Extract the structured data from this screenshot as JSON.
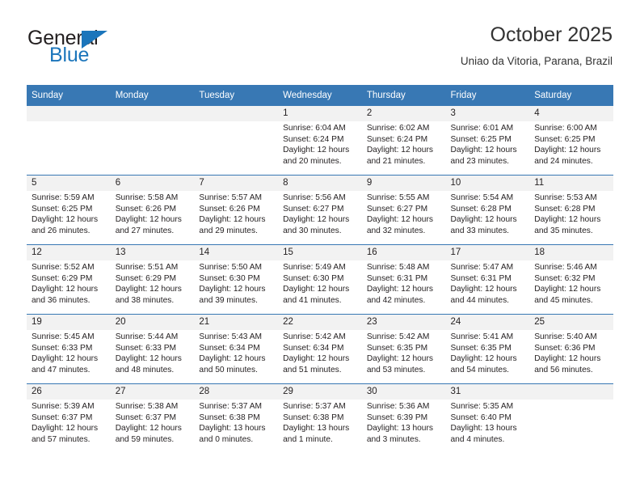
{
  "brand": {
    "name_part1": "General",
    "name_part2": "Blue",
    "accent_color": "#1b75bb"
  },
  "header": {
    "title": "October 2025",
    "subtitle": "Uniao da Vitoria, Parana, Brazil"
  },
  "theme": {
    "header_blue": "#3878b4",
    "row_band_gray": "#f2f2f2"
  },
  "weekdays": [
    "Sunday",
    "Monday",
    "Tuesday",
    "Wednesday",
    "Thursday",
    "Friday",
    "Saturday"
  ],
  "weeks": [
    [
      {
        "day": "",
        "lines": []
      },
      {
        "day": "",
        "lines": []
      },
      {
        "day": "",
        "lines": []
      },
      {
        "day": "1",
        "lines": [
          "Sunrise: 6:04 AM",
          "Sunset: 6:24 PM",
          "Daylight: 12 hours",
          "and 20 minutes."
        ]
      },
      {
        "day": "2",
        "lines": [
          "Sunrise: 6:02 AM",
          "Sunset: 6:24 PM",
          "Daylight: 12 hours",
          "and 21 minutes."
        ]
      },
      {
        "day": "3",
        "lines": [
          "Sunrise: 6:01 AM",
          "Sunset: 6:25 PM",
          "Daylight: 12 hours",
          "and 23 minutes."
        ]
      },
      {
        "day": "4",
        "lines": [
          "Sunrise: 6:00 AM",
          "Sunset: 6:25 PM",
          "Daylight: 12 hours",
          "and 24 minutes."
        ]
      }
    ],
    [
      {
        "day": "5",
        "lines": [
          "Sunrise: 5:59 AM",
          "Sunset: 6:25 PM",
          "Daylight: 12 hours",
          "and 26 minutes."
        ]
      },
      {
        "day": "6",
        "lines": [
          "Sunrise: 5:58 AM",
          "Sunset: 6:26 PM",
          "Daylight: 12 hours",
          "and 27 minutes."
        ]
      },
      {
        "day": "7",
        "lines": [
          "Sunrise: 5:57 AM",
          "Sunset: 6:26 PM",
          "Daylight: 12 hours",
          "and 29 minutes."
        ]
      },
      {
        "day": "8",
        "lines": [
          "Sunrise: 5:56 AM",
          "Sunset: 6:27 PM",
          "Daylight: 12 hours",
          "and 30 minutes."
        ]
      },
      {
        "day": "9",
        "lines": [
          "Sunrise: 5:55 AM",
          "Sunset: 6:27 PM",
          "Daylight: 12 hours",
          "and 32 minutes."
        ]
      },
      {
        "day": "10",
        "lines": [
          "Sunrise: 5:54 AM",
          "Sunset: 6:28 PM",
          "Daylight: 12 hours",
          "and 33 minutes."
        ]
      },
      {
        "day": "11",
        "lines": [
          "Sunrise: 5:53 AM",
          "Sunset: 6:28 PM",
          "Daylight: 12 hours",
          "and 35 minutes."
        ]
      }
    ],
    [
      {
        "day": "12",
        "lines": [
          "Sunrise: 5:52 AM",
          "Sunset: 6:29 PM",
          "Daylight: 12 hours",
          "and 36 minutes."
        ]
      },
      {
        "day": "13",
        "lines": [
          "Sunrise: 5:51 AM",
          "Sunset: 6:29 PM",
          "Daylight: 12 hours",
          "and 38 minutes."
        ]
      },
      {
        "day": "14",
        "lines": [
          "Sunrise: 5:50 AM",
          "Sunset: 6:30 PM",
          "Daylight: 12 hours",
          "and 39 minutes."
        ]
      },
      {
        "day": "15",
        "lines": [
          "Sunrise: 5:49 AM",
          "Sunset: 6:30 PM",
          "Daylight: 12 hours",
          "and 41 minutes."
        ]
      },
      {
        "day": "16",
        "lines": [
          "Sunrise: 5:48 AM",
          "Sunset: 6:31 PM",
          "Daylight: 12 hours",
          "and 42 minutes."
        ]
      },
      {
        "day": "17",
        "lines": [
          "Sunrise: 5:47 AM",
          "Sunset: 6:31 PM",
          "Daylight: 12 hours",
          "and 44 minutes."
        ]
      },
      {
        "day": "18",
        "lines": [
          "Sunrise: 5:46 AM",
          "Sunset: 6:32 PM",
          "Daylight: 12 hours",
          "and 45 minutes."
        ]
      }
    ],
    [
      {
        "day": "19",
        "lines": [
          "Sunrise: 5:45 AM",
          "Sunset: 6:33 PM",
          "Daylight: 12 hours",
          "and 47 minutes."
        ]
      },
      {
        "day": "20",
        "lines": [
          "Sunrise: 5:44 AM",
          "Sunset: 6:33 PM",
          "Daylight: 12 hours",
          "and 48 minutes."
        ]
      },
      {
        "day": "21",
        "lines": [
          "Sunrise: 5:43 AM",
          "Sunset: 6:34 PM",
          "Daylight: 12 hours",
          "and 50 minutes."
        ]
      },
      {
        "day": "22",
        "lines": [
          "Sunrise: 5:42 AM",
          "Sunset: 6:34 PM",
          "Daylight: 12 hours",
          "and 51 minutes."
        ]
      },
      {
        "day": "23",
        "lines": [
          "Sunrise: 5:42 AM",
          "Sunset: 6:35 PM",
          "Daylight: 12 hours",
          "and 53 minutes."
        ]
      },
      {
        "day": "24",
        "lines": [
          "Sunrise: 5:41 AM",
          "Sunset: 6:35 PM",
          "Daylight: 12 hours",
          "and 54 minutes."
        ]
      },
      {
        "day": "25",
        "lines": [
          "Sunrise: 5:40 AM",
          "Sunset: 6:36 PM",
          "Daylight: 12 hours",
          "and 56 minutes."
        ]
      }
    ],
    [
      {
        "day": "26",
        "lines": [
          "Sunrise: 5:39 AM",
          "Sunset: 6:37 PM",
          "Daylight: 12 hours",
          "and 57 minutes."
        ]
      },
      {
        "day": "27",
        "lines": [
          "Sunrise: 5:38 AM",
          "Sunset: 6:37 PM",
          "Daylight: 12 hours",
          "and 59 minutes."
        ]
      },
      {
        "day": "28",
        "lines": [
          "Sunrise: 5:37 AM",
          "Sunset: 6:38 PM",
          "Daylight: 13 hours",
          "and 0 minutes."
        ]
      },
      {
        "day": "29",
        "lines": [
          "Sunrise: 5:37 AM",
          "Sunset: 6:38 PM",
          "Daylight: 13 hours",
          "and 1 minute."
        ]
      },
      {
        "day": "30",
        "lines": [
          "Sunrise: 5:36 AM",
          "Sunset: 6:39 PM",
          "Daylight: 13 hours",
          "and 3 minutes."
        ]
      },
      {
        "day": "31",
        "lines": [
          "Sunrise: 5:35 AM",
          "Sunset: 6:40 PM",
          "Daylight: 13 hours",
          "and 4 minutes."
        ]
      },
      {
        "day": "",
        "lines": []
      }
    ]
  ]
}
